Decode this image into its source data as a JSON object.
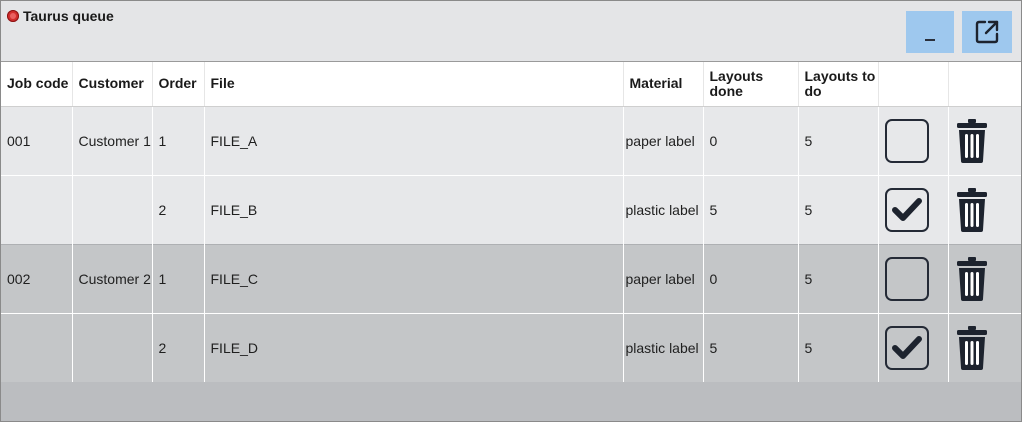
{
  "window": {
    "title": "Taurus queue",
    "status_color": "#d12d2d",
    "minimize_label": "_",
    "popout_icon": "external-link-icon"
  },
  "table": {
    "headers": {
      "job_code": "Job code",
      "customer": "Customer",
      "order": "Order",
      "file": "File",
      "material": "Material",
      "layouts_done": "Layouts done",
      "layouts_to_do": "Layouts to do"
    },
    "rows": [
      {
        "job_code": "001",
        "customer": "Customer 1",
        "order": "1",
        "file": "FILE_A",
        "material": "paper label",
        "layouts_done": "0",
        "layouts_to_do": "5",
        "checked": false
      },
      {
        "job_code": "",
        "customer": "",
        "order": "2",
        "file": "FILE_B",
        "material": "plastic label",
        "layouts_done": "5",
        "layouts_to_do": "5",
        "checked": true
      },
      {
        "job_code": "002",
        "customer": "Customer 2",
        "order": "1",
        "file": "FILE_C",
        "material": "paper label",
        "layouts_done": "0",
        "layouts_to_do": "5",
        "checked": false
      },
      {
        "job_code": "",
        "customer": "",
        "order": "2",
        "file": "FILE_D",
        "material": "plastic label",
        "layouts_done": "5",
        "layouts_to_do": "5",
        "checked": true
      }
    ]
  }
}
